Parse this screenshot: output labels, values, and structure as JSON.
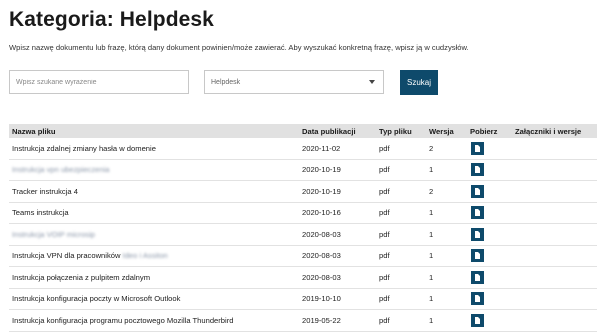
{
  "page": {
    "title": "Kategoria: Helpdesk",
    "description": "Wpisz nazwę dokumentu lub frazę, którą dany dokument powinien/może zawierać. Aby wyszukać konkretną frazę, wpisz ją w cudzysłów."
  },
  "search": {
    "placeholder": "Wpisz szukane wyrażenie",
    "value": "",
    "category_selected": "Helpdesk",
    "button_label": "Szukaj"
  },
  "table": {
    "headers": {
      "name": "Nazwa pliku",
      "date": "Data publikacji",
      "type": "Typ pliku",
      "version": "Wersja",
      "download": "Pobierz",
      "attachments": "Załączniki i wersje"
    },
    "rows": [
      {
        "name": "Instrukcja zdalnej zmiany hasła w domenie",
        "date": "2020-11-02",
        "type": "pdf",
        "version": "2"
      },
      {
        "name": "Instrukcja vpn ubezpieczenia",
        "date": "2020-10-19",
        "type": "pdf",
        "version": "1"
      },
      {
        "name": "Tracker instrukcja 4",
        "date": "2020-10-19",
        "type": "pdf",
        "version": "2"
      },
      {
        "name": "Teams instrukcja",
        "date": "2020-10-16",
        "type": "pdf",
        "version": "1"
      },
      {
        "name": "Instrukcja VOIP microsip",
        "date": "2020-08-03",
        "type": "pdf",
        "version": "1"
      },
      {
        "name": "Instrukcja VPN dla pracowników",
        "name_blur": "Ideo i Assiton",
        "date": "2020-08-03",
        "type": "pdf",
        "version": "1"
      },
      {
        "name": "Instrukcja połączenia z pulpitem zdalnym",
        "date": "2020-08-03",
        "type": "pdf",
        "version": "1"
      },
      {
        "name": "Instrukcja konfiguracja poczty w Microsoft Outlook",
        "date": "2019-10-10",
        "type": "pdf",
        "version": "1"
      },
      {
        "name": "Instrukcja konfiguracja programu pocztowego Mozilla Thunderbird",
        "date": "2019-05-22",
        "type": "pdf",
        "version": "1"
      }
    ]
  },
  "colors": {
    "accent": "#0e4a6b",
    "header_bg": "#e1e1e1"
  },
  "icons": {
    "download": "document-download-icon",
    "dropdown": "chevron-down-icon"
  }
}
